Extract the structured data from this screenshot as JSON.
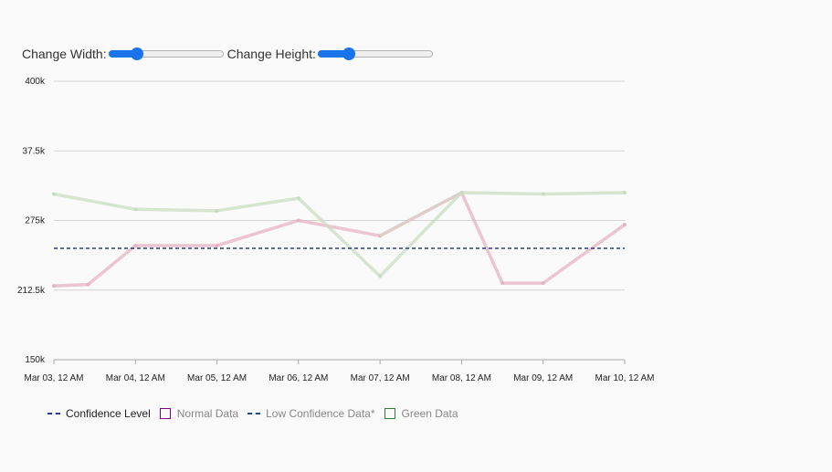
{
  "controls": {
    "width_label": "Change Width:",
    "height_label": "Change Height:",
    "width_value": 0.25,
    "height_value": 0.27
  },
  "colors": {
    "grid": "#d4d4d4",
    "axis": "#aaaaaa",
    "confidence": "#2a3a8f",
    "normal": "#e6b3c3",
    "normal_legend": "#800080",
    "green": "#c9dcc2",
    "green_legend": "#2e7d32",
    "low_conf": "#1f4e79",
    "low_conf_line": "#c9dcc2"
  },
  "legend": [
    {
      "label": "Confidence Level",
      "kind": "dash",
      "color_key": "confidence",
      "muted": false
    },
    {
      "label": "Normal Data",
      "kind": "box",
      "color_key": "normal_legend",
      "muted": true
    },
    {
      "label": "Low Confidence Data*",
      "kind": "dash",
      "color_key": "low_conf",
      "muted": true
    },
    {
      "label": "Green Data",
      "kind": "box",
      "color_key": "green_legend",
      "muted": true
    }
  ],
  "chart_data": {
    "type": "line",
    "x": [
      "Mar 03, 12 AM",
      "Mar 04, 12 AM",
      "Mar 05, 12 AM",
      "Mar 06, 12 AM",
      "Mar 07, 12 AM",
      "Mar 08, 12 AM",
      "Mar 09, 12 AM",
      "Mar 10, 12 AM"
    ],
    "y_ticks": [
      {
        "label": "400k",
        "pos": 1
      },
      {
        "label": "37.5k",
        "pos": 0.75
      },
      {
        "label": "275k",
        "pos": 0.5
      },
      {
        "label": "212.5k",
        "pos": 0.25
      },
      {
        "label": "150k",
        "pos": 0
      }
    ],
    "confidence_level": 0.4,
    "series": [
      {
        "name": "Normal Data",
        "color_key": "normal",
        "points": [
          [
            0,
            0.265
          ],
          [
            0.42,
            0.27
          ],
          [
            1,
            0.41
          ],
          [
            2,
            0.41
          ],
          [
            3,
            0.5
          ],
          [
            4,
            0.445
          ],
          [
            5,
            0.6
          ],
          [
            5.5,
            0.275
          ],
          [
            6,
            0.275
          ],
          [
            7,
            0.485
          ]
        ]
      },
      {
        "name": "Green Data",
        "color_key": "green",
        "points": [
          [
            0,
            0.595
          ],
          [
            1,
            0.54
          ],
          [
            2,
            0.535
          ],
          [
            3,
            0.58
          ],
          [
            4,
            0.3
          ],
          [
            5,
            0.6
          ],
          [
            6,
            0.595
          ],
          [
            7,
            0.6
          ]
        ],
        "dotted_segments": [
          [
            4,
            0.445,
            5,
            0.6
          ]
        ]
      }
    ]
  }
}
